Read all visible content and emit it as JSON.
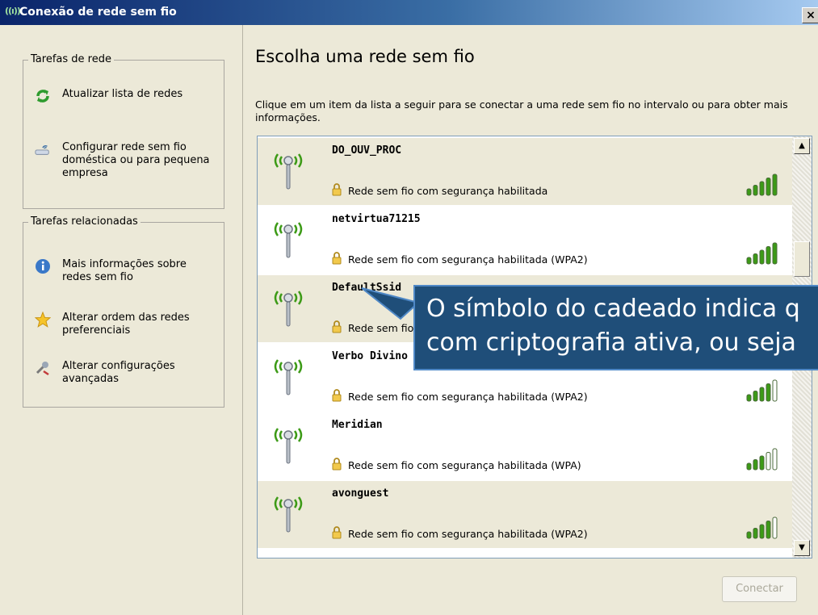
{
  "window": {
    "title": "Conexão de rede sem fio",
    "close_label": "×"
  },
  "sidebar": {
    "network_tasks": {
      "title": "Tarefas de rede",
      "items": [
        {
          "label": "Atualizar lista de redes",
          "icon": "refresh-icon"
        },
        {
          "label": "Configurar rede sem fio doméstica ou para pequena empresa",
          "icon": "wireless-setup-icon"
        }
      ]
    },
    "related_tasks": {
      "title": "Tarefas relacionadas",
      "items": [
        {
          "label": "Mais informações sobre redes sem fio",
          "icon": "info-icon"
        },
        {
          "label": "Alterar ordem das redes preferenciais",
          "icon": "star-icon"
        },
        {
          "label": "Alterar configurações avançadas",
          "icon": "settings-icon"
        }
      ]
    }
  },
  "main": {
    "heading": "Escolha uma rede sem fio",
    "description": "Clique em um item da lista a seguir para se conectar a uma rede sem fio no intervalo ou para obter mais informações.",
    "networks": [
      {
        "ssid": "DO_OUV_PROC",
        "security": "Rede sem fio com segurança habilitada",
        "signal": 5,
        "selected": true
      },
      {
        "ssid": "netvirtua71215",
        "security": "Rede sem fio com segurança habilitada (WPA2)",
        "signal": 5,
        "selected": false
      },
      {
        "ssid": "DefaultSsid",
        "security": "Rede sem fio com segurança habilitada",
        "signal": 5,
        "selected": true
      },
      {
        "ssid": "Verbo Divino",
        "security": "Rede sem fio com segurança habilitada (WPA2)",
        "signal": 4,
        "selected": false
      },
      {
        "ssid": "Meridian",
        "security": "Rede sem fio com segurança habilitada (WPA)",
        "signal": 3,
        "selected": false
      },
      {
        "ssid": "avonguest",
        "security": "Rede sem fio com segurança habilitada (WPA2)",
        "signal": 4,
        "selected": true
      }
    ],
    "connect_label": "Conectar"
  },
  "callout": {
    "line1": "O símbolo do cadeado indica q",
    "line2": "com criptografia ativa, ou seja",
    "background": "#1f4e79"
  },
  "colors": {
    "title_bar": "#0a246a",
    "window_bg": "#ece9d8",
    "signal_green": "#3c9a16"
  }
}
